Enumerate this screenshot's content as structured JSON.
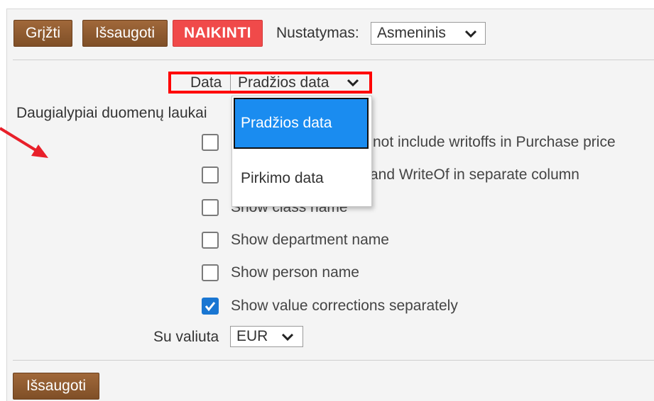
{
  "toolbar": {
    "back_label": "Grįžti",
    "save_label": "Išsaugoti",
    "delete_label": "NAIKINTI",
    "settings_label": "Nustatymas:",
    "settings_value": "Asmeninis"
  },
  "form": {
    "date_label": "Data",
    "date_value": "Pradžios data",
    "multi_fields_label": "Daugialypiai duomenų laukai",
    "date_options": [
      "Pradžios data",
      "Pirkimo data"
    ],
    "checkboxes": [
      {
        "label": "Do not include writoffs in Purchase price",
        "visible_text": "not include writoffs in Purchase price",
        "checked": false
      },
      {
        "label": "Show Purchase and WriteOf in separate column",
        "visible_text": "and WriteOf in separate column",
        "checked": false
      },
      {
        "label": "Show class name",
        "visible_text": "Show class name",
        "checked": false
      },
      {
        "label": "Show department name",
        "visible_text": "Show department name",
        "checked": false
      },
      {
        "label": "Show person name",
        "visible_text": "Show person name",
        "checked": false
      },
      {
        "label": "Show value corrections separately",
        "visible_text": "Show value corrections separately",
        "checked": true
      }
    ],
    "currency_label": "Su valiuta",
    "currency_value": "EUR"
  },
  "footer": {
    "save_label": "Išsaugoti"
  },
  "colors": {
    "button_brown": "#8b5a2b",
    "button_red": "#f04a4a",
    "selected_option": "#1a8cf0",
    "highlight_border": "#ff0000",
    "arrow": "#e8202a",
    "checkbox_checked": "#1976d2"
  }
}
